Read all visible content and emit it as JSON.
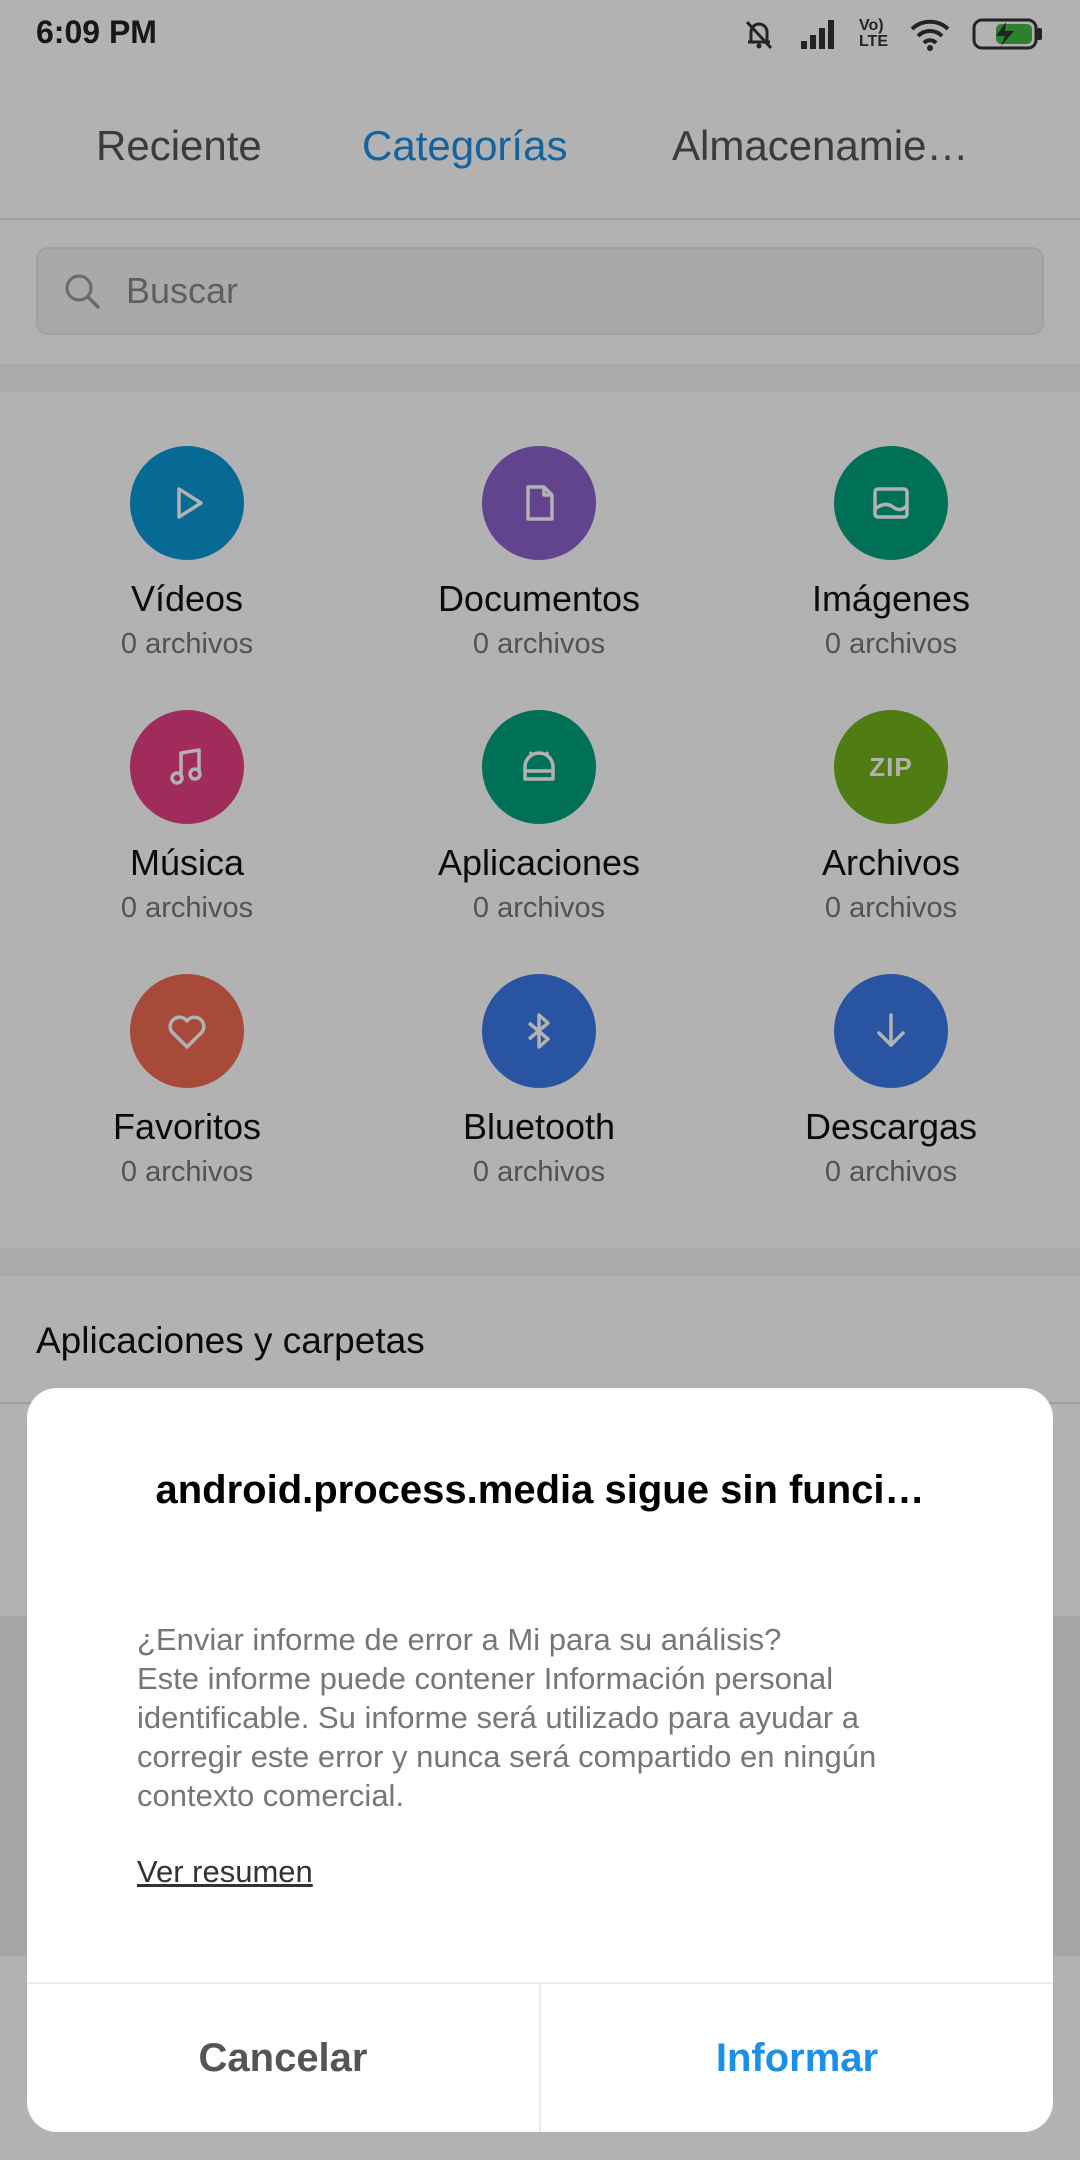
{
  "status_bar": {
    "time": "6:09 PM",
    "icons": [
      "mute-icon",
      "signal-icon",
      "volte-icon",
      "wifi-icon",
      "battery-charging-icon"
    ],
    "volte_top": "Vo)",
    "volte_bottom": "LTE"
  },
  "tabs": [
    {
      "label": "Reciente",
      "active": false
    },
    {
      "label": "Categorías",
      "active": true
    },
    {
      "label": "Almacenamie…",
      "active": false
    }
  ],
  "search": {
    "placeholder": "Buscar"
  },
  "categories": [
    {
      "name": "Vídeos",
      "count": "0 archivos",
      "icon": "play-icon",
      "color": "#0a98d6"
    },
    {
      "name": "Documentos",
      "count": "0 archivos",
      "icon": "document-icon",
      "color": "#8c60cc"
    },
    {
      "name": "Imágenes",
      "count": "0 archivos",
      "icon": "image-icon",
      "color": "#00a37c"
    },
    {
      "name": "Música",
      "count": "0 archivos",
      "icon": "music-icon",
      "color": "#e43f82"
    },
    {
      "name": "Aplicaciones",
      "count": "0 archivos",
      "icon": "android-icon",
      "color": "#00a37c"
    },
    {
      "name": "Archivos",
      "count": "0 archivos",
      "icon": "zip-icon",
      "icon_text": "ZIP",
      "color": "#73b21e"
    },
    {
      "name": "Favoritos",
      "count": "0 archivos",
      "icon": "heart-icon",
      "color": "#ef6b52"
    },
    {
      "name": "Bluetooth",
      "count": "0 archivos",
      "icon": "bluetooth-icon",
      "color": "#3a79e8"
    },
    {
      "name": "Descargas",
      "count": "0 archivos",
      "icon": "download-icon",
      "color": "#3a79e8"
    }
  ],
  "apps_section": {
    "title": "Aplicaciones y carpetas"
  },
  "dialog": {
    "title": "android.process.media sigue sin funci…",
    "body_lines": [
      "¿Enviar informe de error a Mi para su análisis?",
      "Este informe puede contener Información personal",
      "identificable. Su informe será utilizado para ayudar a",
      "corregir este error y nunca será compartido en ningún",
      "contexto comercial."
    ],
    "link": "Ver resumen",
    "cancel_label": "Cancelar",
    "confirm_label": "Informar"
  }
}
